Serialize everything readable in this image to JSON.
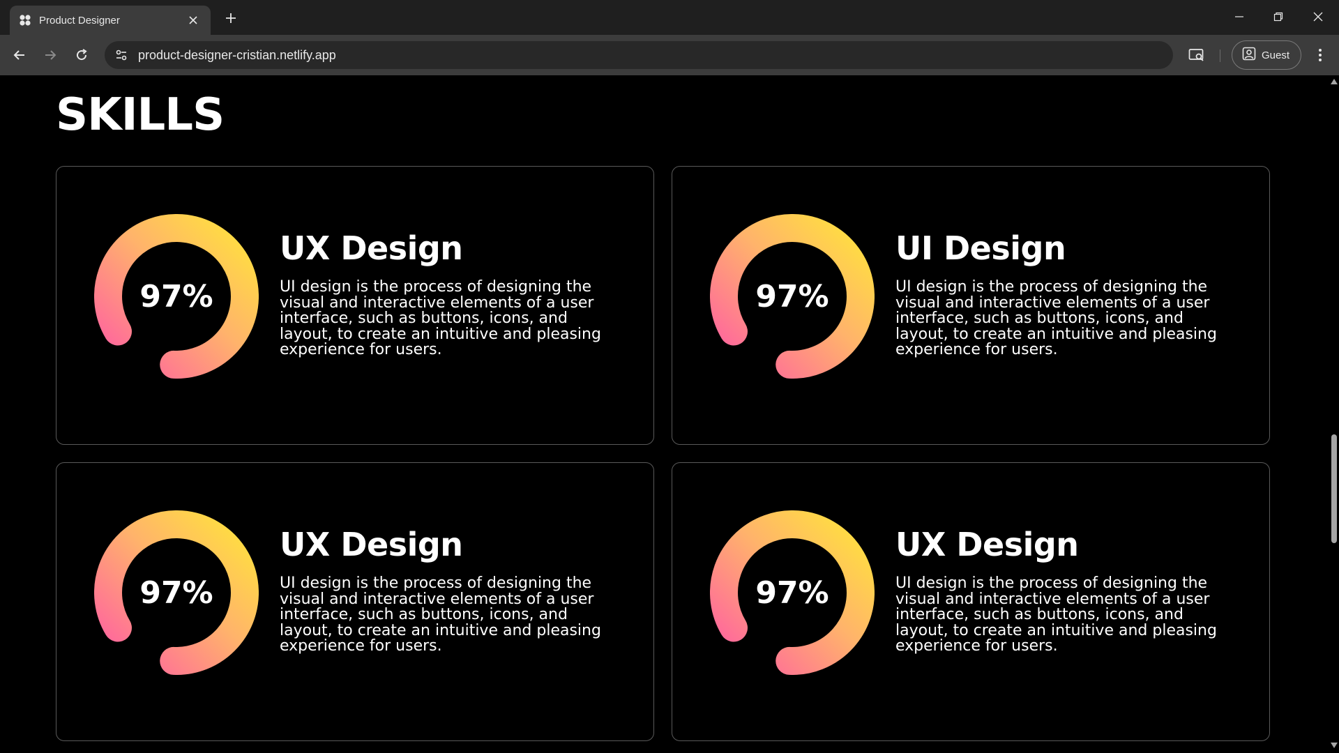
{
  "browser": {
    "tab_title": "Product Designer",
    "url": "product-designer-cristian.netlify.app",
    "profile_label": "Guest",
    "icons": {
      "favicon": "app-favicon-icon",
      "close": "close-icon",
      "new_tab": "plus-icon",
      "back": "arrow-left-icon",
      "forward": "arrow-right-icon",
      "reload": "reload-icon",
      "site_info": "site-settings-icon",
      "cast": "cast-search-icon",
      "profile": "profile-icon",
      "menu": "kebab-menu-icon"
    }
  },
  "page": {
    "title": "SKILLS",
    "skills": [
      {
        "title": "UX Design",
        "percent_label": "97%",
        "percent": 97,
        "description": "UI design is the process of designing the visual and interactive elements of a user interface, such as buttons, icons, and layout, to create an intuitive and pleasing experience for users."
      },
      {
        "title": "UI Design",
        "percent_label": "97%",
        "percent": 97,
        "description": "UI design is the process of designing the visual and interactive elements of a user interface, such as buttons, icons, and layout, to create an intuitive and pleasing experience for users."
      },
      {
        "title": "UX Design",
        "percent_label": "97%",
        "percent": 97,
        "description": "UI design is the process of designing the visual and interactive elements of a user interface, such as buttons, icons, and layout, to create an intuitive and pleasing experience for users."
      },
      {
        "title": "UX Design",
        "percent_label": "97%",
        "percent": 97,
        "description": "UI design is the process of designing the visual and interactive elements of a user interface, such as buttons, icons, and layout, to create an intuitive and pleasing experience for users."
      }
    ]
  },
  "colors": {
    "ring_gradient_start": "#ff5fa2",
    "ring_gradient_mid": "#ffb36b",
    "ring_gradient_end": "#ffe23d",
    "background": "#000000",
    "card_border": "#5a5a5a"
  }
}
